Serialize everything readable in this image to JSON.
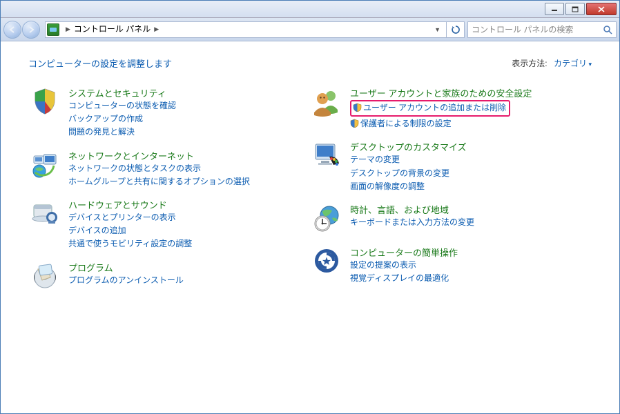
{
  "breadcrumb": {
    "root": "コントロール パネル"
  },
  "search": {
    "placeholder": "コントロール パネルの検索"
  },
  "page": {
    "heading": "コンピューターの設定を調整します",
    "viewby_label": "表示方法:",
    "viewby_value": "カテゴリ"
  },
  "cats": {
    "system": {
      "name": "システムとセキュリティ",
      "links": [
        "コンピューターの状態を確認",
        "バックアップの作成",
        "問題の発見と解決"
      ]
    },
    "network": {
      "name": "ネットワークとインターネット",
      "links": [
        "ネットワークの状態とタスクの表示",
        "ホームグループと共有に関するオプションの選択"
      ]
    },
    "hardware": {
      "name": "ハードウェアとサウンド",
      "links": [
        "デバイスとプリンターの表示",
        "デバイスの追加",
        "共通で使うモビリティ設定の調整"
      ]
    },
    "programs": {
      "name": "プログラム",
      "links": [
        "プログラムのアンインストール"
      ]
    },
    "users": {
      "name": "ユーザー アカウントと家族のための安全設定",
      "links": [
        "ユーザー アカウントの追加または削除",
        "保護者による制限の設定"
      ]
    },
    "appearance": {
      "name": "デスクトップのカスタマイズ",
      "links": [
        "テーマの変更",
        "デスクトップの背景の変更",
        "画面の解像度の調整"
      ]
    },
    "clock": {
      "name": "時計、言語、および地域",
      "links": [
        "キーボードまたは入力方法の変更"
      ]
    },
    "ease": {
      "name": "コンピューターの簡単操作",
      "links": [
        "設定の提案の表示",
        "視覚ディスプレイの最適化"
      ]
    }
  }
}
